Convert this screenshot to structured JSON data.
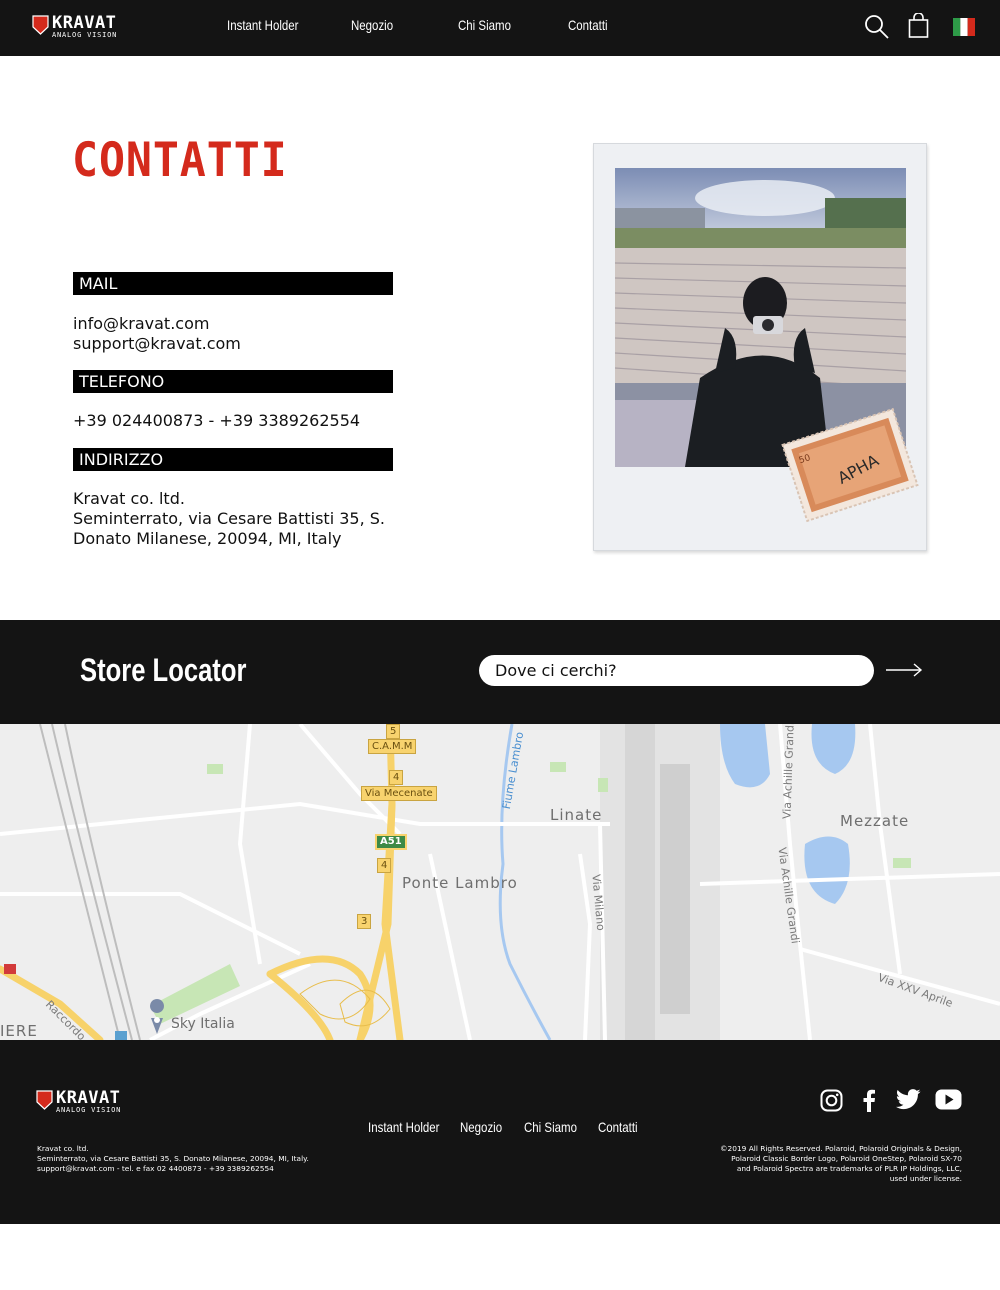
{
  "header": {
    "logo": {
      "brand": "KRAVAT",
      "tagline": "ANALOG VISION"
    },
    "nav": [
      "Instant Holder",
      "Negozio",
      "Chi Siamo",
      "Contatti"
    ],
    "icons": [
      "search-icon",
      "cart-icon",
      "italian-flag-icon"
    ]
  },
  "contact": {
    "title": "CONTATTI",
    "mail": {
      "label": "MAIL",
      "lines": [
        "info@kravat.com",
        "support@kravat.com"
      ]
    },
    "phone": {
      "label": "TELEFONO",
      "value": "+39 024400873 - +39 3389262554"
    },
    "address": {
      "label": "INDIRIZZO",
      "lines": [
        "Kravat co. ltd.",
        "Seminterrato, via Cesare Battisti 35, S.",
        "Donato Milanese, 20094, MI, Italy"
      ]
    },
    "stamp": {
      "value": "50",
      "text": "APHA"
    }
  },
  "locator": {
    "title": "Store Locator",
    "search_placeholder": "Dove ci cerchi?"
  },
  "map": {
    "places": [
      "Linate",
      "Mezzate",
      "Ponte Lambro",
      "Sky Italia"
    ],
    "roads": [
      "Fiume Lambro",
      "Via Milano",
      "Via Achille Grandi",
      "Via Achille Grandi",
      "Via XXV Aprile",
      "Raccordo"
    ],
    "shields": [
      "5",
      "C.A.M.M",
      "4",
      "Via Mecenate",
      "A51",
      "4",
      "3"
    ],
    "edge_label": "IERE",
    "colors": {
      "road_major": "#f7d26a",
      "water": "#a6c8f0",
      "park": "#c7e6b5"
    }
  },
  "footer": {
    "logo": {
      "brand": "KRAVAT",
      "tagline": "ANALOG VISION"
    },
    "nav": [
      "Instant Holder",
      "Negozio",
      "Chi Siamo",
      "Contatti"
    ],
    "company": [
      "Kravat  co. ltd.",
      "Seminterrato, via Cesare Battisti 35, S. Donato Milanese, 20094, MI, Italy.",
      "support@kravat.com - tel. e fax 02 4400873 - +39 3389262554"
    ],
    "legal": [
      "©2019 All Rights Reserved. Polaroid, Polaroid Originals & Design,",
      "Polaroid Classic Border Logo, Polaroid OneStep, Polaroid SX-70",
      "and Polaroid Spectra are trademarks of PLR IP Holdings, LLC,",
      "used under license."
    ],
    "social_icons": [
      "instagram-icon",
      "facebook-icon",
      "twitter-icon",
      "youtube-icon"
    ]
  }
}
